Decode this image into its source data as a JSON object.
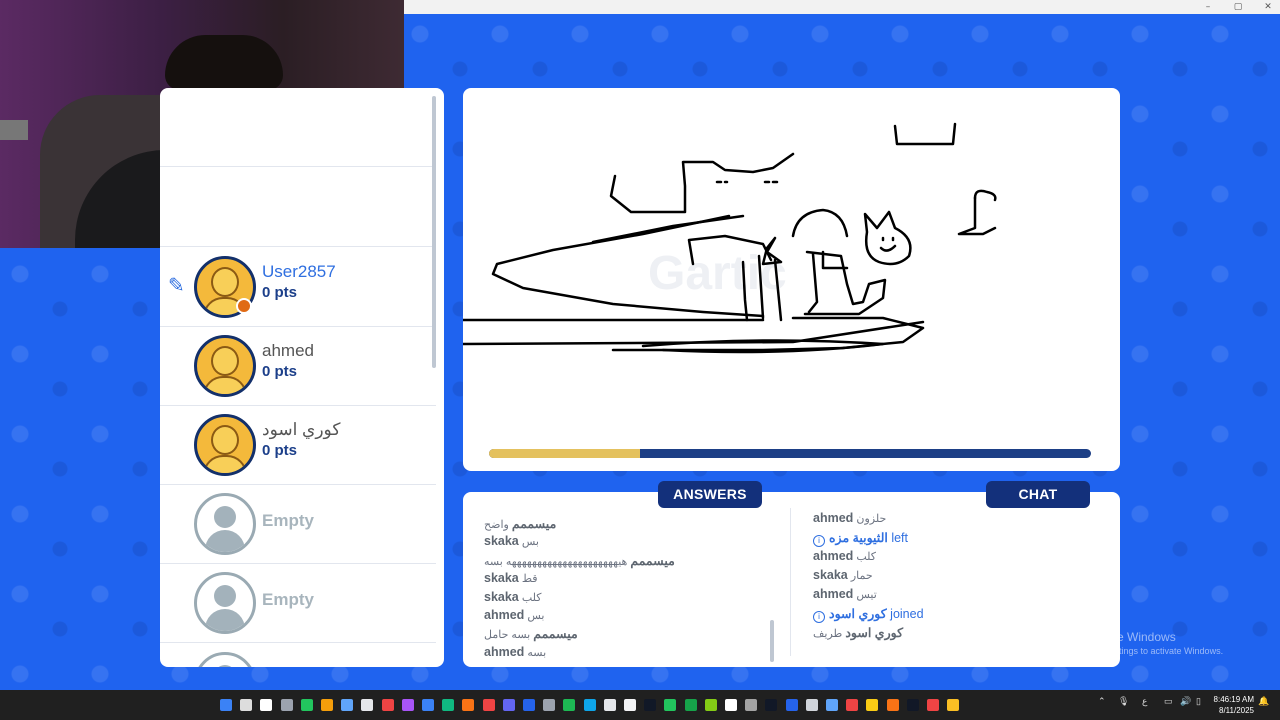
{
  "window_controls": {
    "minimize": "–",
    "maximize": "▢",
    "close": "✕"
  },
  "players": [
    {
      "name": "User2857",
      "points": "0 pts",
      "drawing": true,
      "me": true,
      "icon": "pencil-icon"
    },
    {
      "name": "ahmed",
      "points": "0 pts"
    },
    {
      "name": "كوري اسود",
      "points": "0 pts"
    },
    {
      "name": "Empty",
      "empty": true
    },
    {
      "name": "Empty",
      "empty": true
    }
  ],
  "canvas": {
    "watermark": "Gartic",
    "progress_fraction": 0.25
  },
  "tabs": {
    "answers": "ANSWERS",
    "chat": "CHAT"
  },
  "answers": [
    {
      "user": "ميسممم",
      "text": "واضح"
    },
    {
      "user": "skaka",
      "text": "بس"
    },
    {
      "user": "ميسممم",
      "text": "هيهههههههههههههههههههههه بسه"
    },
    {
      "user": "skaka",
      "text": "قط"
    },
    {
      "user": "skaka",
      "text": "كلب"
    },
    {
      "user": "ahmed",
      "text": "بس"
    },
    {
      "user": "ميسممم",
      "text": "بسه حامل"
    },
    {
      "user": "ahmed",
      "text": "بسه"
    }
  ],
  "chat": [
    {
      "user": "ahmed",
      "text": "حلزون"
    },
    {
      "user": "الثيوبية مزه",
      "text": "left",
      "system": true
    },
    {
      "user": "ahmed",
      "text": "كلب"
    },
    {
      "user": "skaka",
      "text": "حمار"
    },
    {
      "user": "ahmed",
      "text": "تيس"
    },
    {
      "user": "كوري اسود",
      "text": "joined",
      "system": true
    },
    {
      "user": "كوري اسود",
      "text": "طريف"
    }
  ],
  "watermark_windows": {
    "line1": "Activate Windows",
    "line2": "Go to Settings to activate Windows."
  },
  "taskbar": {
    "lang": "ع",
    "time": "8:46:19 AM",
    "date": "8/11/2025",
    "icon_colors": [
      "#3b82f6",
      "#dddddd",
      "#ffffff",
      "#9ca3af",
      "#22c55e",
      "#f59e0b",
      "#60a5fa",
      "#e5e7eb",
      "#ef4444",
      "#a855f7",
      "#3b82f6",
      "#10b981",
      "#f97316",
      "#ef4444",
      "#6366f1",
      "#2563eb",
      "#9ca3af",
      "#1db954",
      "#0ea5e9",
      "#e5e7eb",
      "#f3f4f6",
      "#111827",
      "#22c55e",
      "#16a34a",
      "#84cc16",
      "#ffffff",
      "#a3a3a3",
      "#111827",
      "#2563eb",
      "#d1d5db",
      "#60a5fa",
      "#ef4444",
      "#facc15",
      "#f97316",
      "#111827",
      "#ef4444",
      "#fbbf24"
    ]
  }
}
